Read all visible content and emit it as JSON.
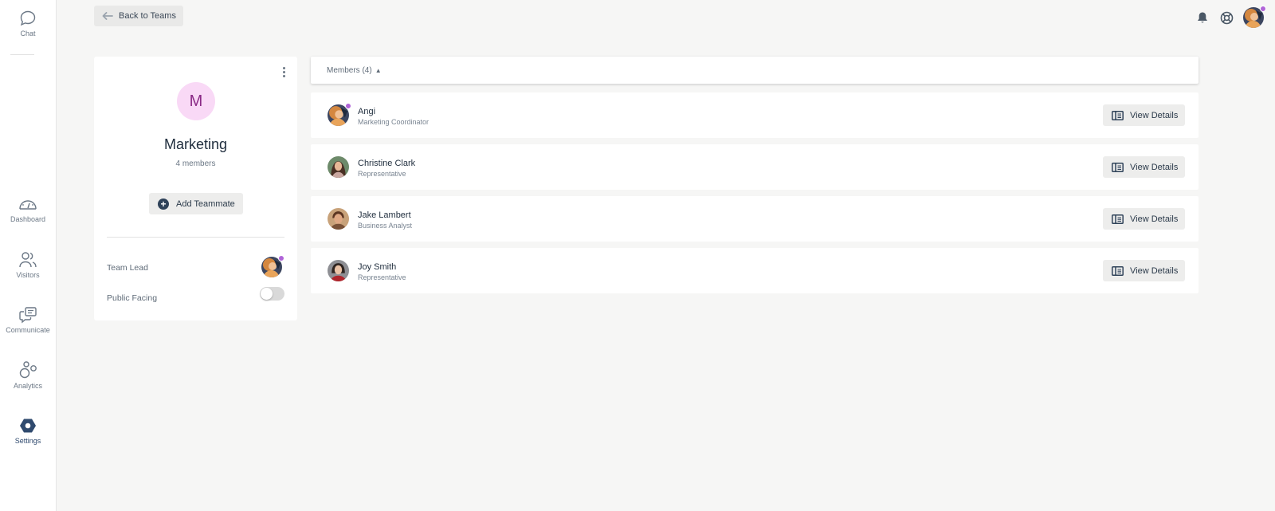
{
  "sidebar": {
    "items": [
      {
        "label": "Chat",
        "icon": "chat-bubble-icon"
      },
      {
        "label": "Dashboard",
        "icon": "gauge-icon"
      },
      {
        "label": "Visitors",
        "icon": "users-icon"
      },
      {
        "label": "Communicate",
        "icon": "messages-icon"
      },
      {
        "label": "Analytics",
        "icon": "circles-icon"
      },
      {
        "label": "Settings",
        "icon": "hexagon-gear-icon",
        "active": true
      }
    ]
  },
  "topbar": {
    "back_label": "Back to Teams",
    "icons": [
      "bell-icon",
      "help-lifebuoy-icon",
      "user-avatar"
    ]
  },
  "team": {
    "initial": "M",
    "name": "Marketing",
    "member_count": "4 members",
    "add_label": "Add Teammate",
    "team_lead_label": "Team Lead",
    "public_facing_label": "Public Facing",
    "public_facing": false
  },
  "members": {
    "header": "Members (4)",
    "view_label": "View Details",
    "list": [
      {
        "name": "Angi",
        "role": "Marketing Coordinator",
        "online": true
      },
      {
        "name": "Christine Clark",
        "role": "Representative",
        "online": false
      },
      {
        "name": "Jake Lambert",
        "role": "Business Analyst",
        "online": false
      },
      {
        "name": "Joy Smith",
        "role": "Representative",
        "online": false
      }
    ]
  },
  "colors": {
    "accent": "#2f4a6e",
    "status_online": "#b064d8",
    "team_badge_bg": "#f9d9f6",
    "team_badge_text": "#8a2a86"
  }
}
